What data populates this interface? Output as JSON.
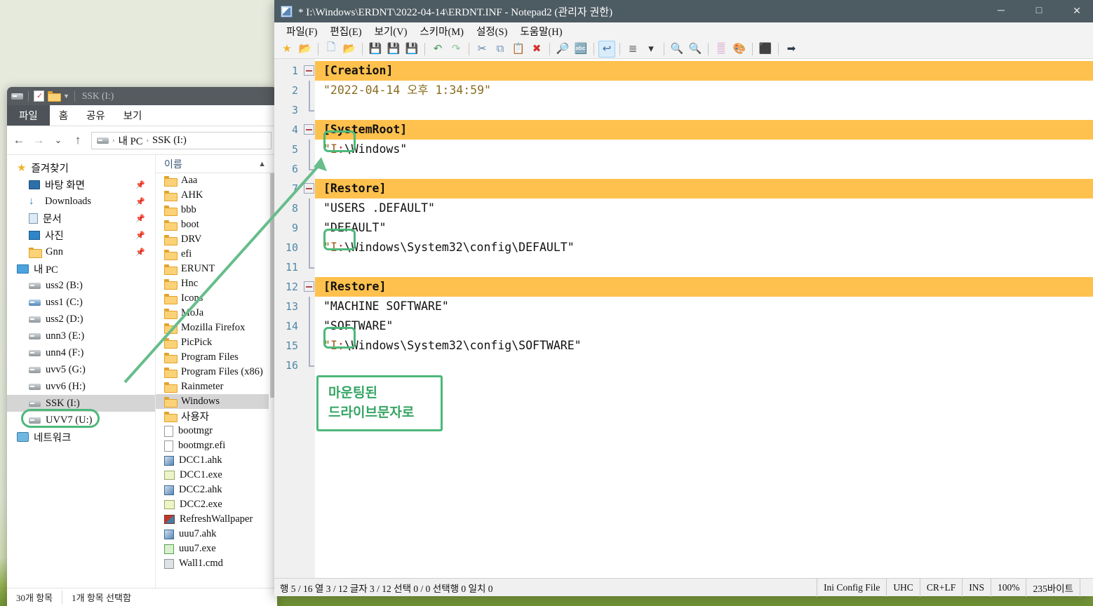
{
  "desktop": {
    "bg_top": "#e6eadd",
    "bg_grass": "#6f9234"
  },
  "annotation": {
    "accent_color": "#4cb87a",
    "box_line1": "마운팅된",
    "box_line2": "드라이브문자로"
  },
  "explorer": {
    "title": "SSK (I:)",
    "quick_access": [
      "drive-icon",
      "properties-icon",
      "new-folder-icon",
      "customize-chevron-icon"
    ],
    "ribbon_tabs": [
      {
        "label": "파일",
        "selected": true
      },
      {
        "label": "홈",
        "selected": false
      },
      {
        "label": "공유",
        "selected": false
      },
      {
        "label": "보기",
        "selected": false
      }
    ],
    "nav": {
      "back": "←",
      "forward": "→",
      "recent": "⌄",
      "up": "↑"
    },
    "breadcrumb": [
      "내 PC",
      "SSK (I:)"
    ],
    "tree": [
      {
        "label": "즐겨찾기",
        "icon": "star-icon",
        "level": 0,
        "pinned": false,
        "selected": false
      },
      {
        "label": "바탕 화면",
        "icon": "desktop-icon",
        "level": 1,
        "pinned": true,
        "selected": false
      },
      {
        "label": "Downloads",
        "icon": "download-icon",
        "level": 1,
        "pinned": true,
        "selected": false
      },
      {
        "label": "문서",
        "icon": "documents-icon",
        "level": 1,
        "pinned": true,
        "selected": false
      },
      {
        "label": "사진",
        "icon": "pictures-icon",
        "level": 1,
        "pinned": true,
        "selected": false
      },
      {
        "label": "Gnn",
        "icon": "folder-icon",
        "level": 1,
        "pinned": true,
        "selected": false
      },
      {
        "label": "내 PC",
        "icon": "this-pc-icon",
        "level": 0,
        "pinned": false,
        "selected": false
      },
      {
        "label": "uss2 (B:)",
        "icon": "drive-icon",
        "level": 1,
        "pinned": false,
        "selected": false
      },
      {
        "label": "uss1 (C:)",
        "icon": "system-drive-icon",
        "level": 1,
        "pinned": false,
        "selected": false
      },
      {
        "label": "uss2 (D:)",
        "icon": "drive-icon",
        "level": 1,
        "pinned": false,
        "selected": false
      },
      {
        "label": "unn3 (E:)",
        "icon": "drive-icon",
        "level": 1,
        "pinned": false,
        "selected": false
      },
      {
        "label": "unn4 (F:)",
        "icon": "drive-icon",
        "level": 1,
        "pinned": false,
        "selected": false
      },
      {
        "label": "uvv5 (G:)",
        "icon": "drive-icon",
        "level": 1,
        "pinned": false,
        "selected": false
      },
      {
        "label": "uvv6 (H:)",
        "icon": "drive-icon",
        "level": 1,
        "pinned": false,
        "selected": false
      },
      {
        "label": "SSK (I:)",
        "icon": "drive-icon",
        "level": 1,
        "pinned": false,
        "selected": true
      },
      {
        "label": "UVV7 (U:)",
        "icon": "drive-icon",
        "level": 1,
        "pinned": false,
        "selected": false
      },
      {
        "label": "네트워크",
        "icon": "network-icon",
        "level": 0,
        "pinned": false,
        "selected": false
      }
    ],
    "list_header": "이름",
    "files": [
      {
        "name": "Aaa",
        "type": "folder",
        "selected": false
      },
      {
        "name": "AHK",
        "type": "folder",
        "selected": false
      },
      {
        "name": "bbb",
        "type": "folder",
        "selected": false
      },
      {
        "name": "boot",
        "type": "folder",
        "selected": false
      },
      {
        "name": "DRV",
        "type": "folder",
        "selected": false
      },
      {
        "name": "efi",
        "type": "folder",
        "selected": false
      },
      {
        "name": "ERUNT",
        "type": "folder",
        "selected": false
      },
      {
        "name": "Hnc",
        "type": "folder",
        "selected": false
      },
      {
        "name": "Icons",
        "type": "folder",
        "selected": false
      },
      {
        "name": "MoJa",
        "type": "folder",
        "selected": false
      },
      {
        "name": "Mozilla Firefox",
        "type": "folder",
        "selected": false
      },
      {
        "name": "PicPick",
        "type": "folder",
        "selected": false
      },
      {
        "name": "Program Files",
        "type": "folder",
        "selected": false
      },
      {
        "name": "Program Files (x86)",
        "type": "folder",
        "selected": false
      },
      {
        "name": "Rainmeter",
        "type": "folder",
        "selected": false
      },
      {
        "name": "Windows",
        "type": "folder",
        "selected": true
      },
      {
        "name": "사용자",
        "type": "folder",
        "selected": false
      },
      {
        "name": "bootmgr",
        "type": "file",
        "selected": false
      },
      {
        "name": "bootmgr.efi",
        "type": "file",
        "selected": false
      },
      {
        "name": "DCC1.ahk",
        "type": "ahk",
        "selected": false
      },
      {
        "name": "DCC1.exe",
        "type": "exe",
        "selected": false
      },
      {
        "name": "DCC2.ahk",
        "type": "ahk",
        "selected": false
      },
      {
        "name": "DCC2.exe",
        "type": "exe",
        "selected": false
      },
      {
        "name": "RefreshWallpaper",
        "type": "exe2",
        "selected": false
      },
      {
        "name": "uuu7.ahk",
        "type": "ahk",
        "selected": false
      },
      {
        "name": "uuu7.exe",
        "type": "exe3",
        "selected": false
      },
      {
        "name": "Wall1.cmd",
        "type": "cmd",
        "selected": false
      }
    ],
    "status": {
      "items": "30개 항목",
      "selected": "1개 항목 선택함"
    }
  },
  "notepad": {
    "title": "* I:\\Windows\\ERDNT\\2022-04-14\\ERDNT.INF - Notepad2 (관리자 권한)",
    "window_buttons": {
      "minimize": "─",
      "maximize": "□",
      "close": "✕"
    },
    "menu": [
      "파일(F)",
      "편집(E)",
      "보기(V)",
      "스키마(M)",
      "설정(S)",
      "도움말(H)"
    ],
    "toolbar": [
      "favorites-icon",
      "open-favorites-icon",
      "sep",
      "new-file-icon",
      "open-file-icon",
      "sep",
      "save-icon",
      "save-as-icon",
      "save-copy-icon",
      "sep",
      "undo-icon",
      "redo-icon",
      "sep",
      "cut-icon",
      "copy-icon",
      "paste-icon",
      "delete-icon",
      "sep",
      "find-icon",
      "replace-icon",
      "sep",
      "word-wrap-icon",
      "sep",
      "line-numbers-icon",
      "chevron-down-icon",
      "sep",
      "zoom-in-icon",
      "zoom-out-icon",
      "sep",
      "scheme-icon",
      "color-palette-icon",
      "sep",
      "console-icon",
      "sep",
      "exit-icon"
    ],
    "lines": [
      {
        "n": 1,
        "text": "[Creation]",
        "section": true,
        "fold": "start"
      },
      {
        "n": 2,
        "text": "\"2022-04-14 오후 1:34:59\"",
        "section": false,
        "fold": "mid",
        "string": true
      },
      {
        "n": 3,
        "text": "",
        "section": false,
        "fold": "end"
      },
      {
        "n": 4,
        "text": "[SystemRoot]",
        "section": true,
        "fold": "start"
      },
      {
        "n": 5,
        "text": "\"I:\\Windows\"",
        "section": false,
        "fold": "mid",
        "drive": true
      },
      {
        "n": 6,
        "text": "",
        "section": false,
        "fold": "end"
      },
      {
        "n": 7,
        "text": "[Restore]",
        "section": true,
        "fold": "start"
      },
      {
        "n": 8,
        "text": "\"USERS .DEFAULT\"",
        "section": false,
        "fold": "mid"
      },
      {
        "n": 9,
        "text": "\"DEFAULT\"",
        "section": false,
        "fold": "mid"
      },
      {
        "n": 10,
        "text": "\"I:\\Windows\\System32\\config\\DEFAULT\"",
        "section": false,
        "fold": "mid",
        "drive": true
      },
      {
        "n": 11,
        "text": "",
        "section": false,
        "fold": "end"
      },
      {
        "n": 12,
        "text": "[Restore]",
        "section": true,
        "fold": "start"
      },
      {
        "n": 13,
        "text": "\"MACHINE SOFTWARE\"",
        "section": false,
        "fold": "mid"
      },
      {
        "n": 14,
        "text": "\"SOFTWARE\"",
        "section": false,
        "fold": "mid"
      },
      {
        "n": 15,
        "text": "\"I:\\Windows\\System32\\config\\SOFTWARE\"",
        "section": false,
        "fold": "mid",
        "drive": true
      },
      {
        "n": 16,
        "text": "",
        "section": false,
        "fold": "end"
      }
    ],
    "status": {
      "position": "행 5 / 16  열 3 / 12  글자 3 / 12  선택 0 / 0  선택행 0  일치 0",
      "filetype": "Ini Config File",
      "encoding": "UHC",
      "eol": "CR+LF",
      "insert_mode": "INS",
      "zoom": "100%",
      "size": "235바이트"
    },
    "section_highlight_color": "#ffc14d"
  }
}
